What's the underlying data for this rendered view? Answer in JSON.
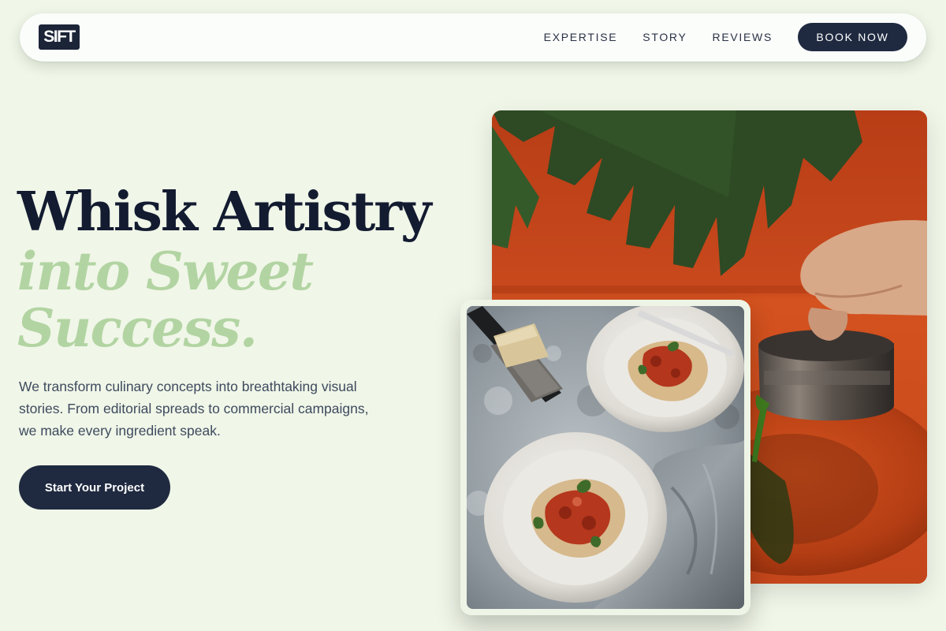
{
  "brand": {
    "logo_text": "SIFT"
  },
  "nav": {
    "links": [
      "EXPERTISE",
      "STORY",
      "REVIEWS"
    ],
    "book_label": "BOOK NOW"
  },
  "hero": {
    "headline": "Whisk Artistry",
    "headline_accent": "into Sweet Success.",
    "description": "We transform culinary concepts into breathtaking visual stories. From editorial spreads to commercial campaigns, we make every ingredient speak.",
    "cta_label": "Start Your Project"
  },
  "images": {
    "back": {
      "subject": "hand pouring green sauce from a metal jug onto an orange plate with a monstera leaf"
    },
    "front": {
      "subject": "two plates of tagliatelle bolognese with basil on a grey stone surface, grater with cheese and a fork"
    }
  },
  "colors": {
    "page_background": "#f0f6e8",
    "navy": "#1f2a40",
    "headline": "#131b30",
    "accent_green": "#b2d4a2",
    "orange": "#c2461c"
  }
}
